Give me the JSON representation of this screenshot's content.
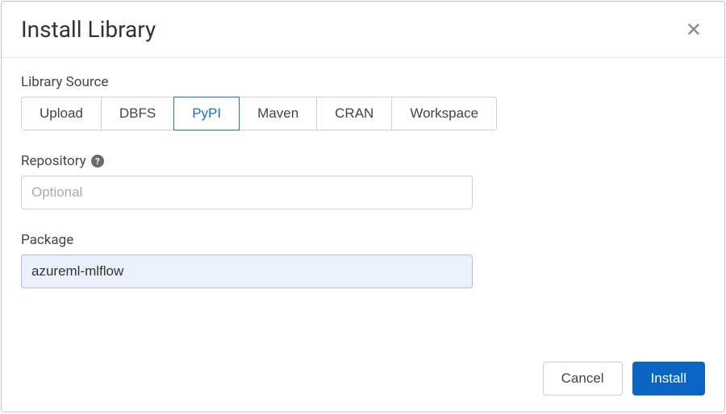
{
  "dialog": {
    "title": "Install Library",
    "labels": {
      "source": "Library Source",
      "repository": "Repository",
      "package": "Package"
    },
    "sources": {
      "upload": "Upload",
      "dbfs": "DBFS",
      "pypi": "PyPI",
      "maven": "Maven",
      "cran": "CRAN",
      "workspace": "Workspace"
    },
    "repository": {
      "placeholder": "Optional",
      "value": ""
    },
    "package": {
      "value": "azureml-mlflow"
    },
    "buttons": {
      "cancel": "Cancel",
      "install": "Install"
    },
    "help_glyph": "?"
  }
}
